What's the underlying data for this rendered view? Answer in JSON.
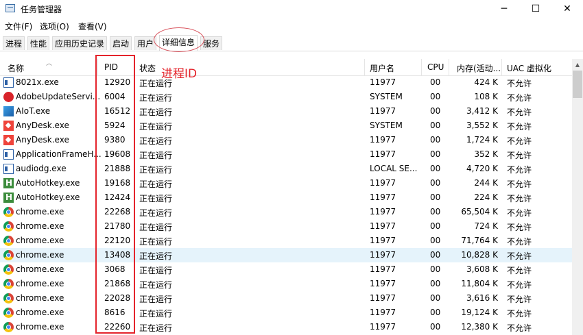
{
  "window": {
    "title": "任务管理器",
    "controls": {
      "minimize": "─",
      "maximize": "☐",
      "close": "✕"
    }
  },
  "menu": [
    "文件(F)",
    "选项(O)",
    "查看(V)"
  ],
  "tabs": [
    "进程",
    "性能",
    "应用历史记录",
    "启动",
    "用户",
    "详细信息",
    "服务"
  ],
  "active_tab": "详细信息",
  "columns": {
    "name": "名称",
    "pid": "PID",
    "status": "状态",
    "user": "用户名",
    "cpu": "CPU",
    "memory": "内存(活动...",
    "uac": "UAC 虚拟化"
  },
  "annotation": "进程ID",
  "rows": [
    {
      "name": "8021x.exe",
      "pid": "12920",
      "status": "正在运行",
      "user": "11977",
      "cpu": "00",
      "memory": "424 K",
      "uac": "不允许",
      "icon": "window-app-icon"
    },
    {
      "name": "AdobeUpdateServi...",
      "pid": "6004",
      "status": "正在运行",
      "user": "SYSTEM",
      "cpu": "00",
      "memory": "108 K",
      "uac": "不允许",
      "icon": "adobe-icon"
    },
    {
      "name": "AIoT.exe",
      "pid": "16512",
      "status": "正在运行",
      "user": "11977",
      "cpu": "00",
      "memory": "3,412 K",
      "uac": "不允许",
      "icon": "aiot-icon"
    },
    {
      "name": "AnyDesk.exe",
      "pid": "5924",
      "status": "正在运行",
      "user": "SYSTEM",
      "cpu": "00",
      "memory": "3,552 K",
      "uac": "不允许",
      "icon": "anydesk-icon"
    },
    {
      "name": "AnyDesk.exe",
      "pid": "9380",
      "status": "正在运行",
      "user": "11977",
      "cpu": "00",
      "memory": "1,724 K",
      "uac": "不允许",
      "icon": "anydesk-icon"
    },
    {
      "name": "ApplicationFrameH...",
      "pid": "19608",
      "status": "正在运行",
      "user": "11977",
      "cpu": "00",
      "memory": "352 K",
      "uac": "不允许",
      "icon": "window-app-icon"
    },
    {
      "name": "audiodg.exe",
      "pid": "21888",
      "status": "正在运行",
      "user": "LOCAL SE...",
      "cpu": "00",
      "memory": "4,720 K",
      "uac": "不允许",
      "icon": "window-app-icon"
    },
    {
      "name": "AutoHotkey.exe",
      "pid": "19168",
      "status": "正在运行",
      "user": "11977",
      "cpu": "00",
      "memory": "244 K",
      "uac": "不允许",
      "icon": "autohotkey-icon"
    },
    {
      "name": "AutoHotkey.exe",
      "pid": "12424",
      "status": "正在运行",
      "user": "11977",
      "cpu": "00",
      "memory": "224 K",
      "uac": "不允许",
      "icon": "autohotkey-icon"
    },
    {
      "name": "chrome.exe",
      "pid": "22268",
      "status": "正在运行",
      "user": "11977",
      "cpu": "00",
      "memory": "65,504 K",
      "uac": "不允许",
      "icon": "chrome-icon"
    },
    {
      "name": "chrome.exe",
      "pid": "21780",
      "status": "正在运行",
      "user": "11977",
      "cpu": "00",
      "memory": "724 K",
      "uac": "不允许",
      "icon": "chrome-icon"
    },
    {
      "name": "chrome.exe",
      "pid": "22120",
      "status": "正在运行",
      "user": "11977",
      "cpu": "00",
      "memory": "71,764 K",
      "uac": "不允许",
      "icon": "chrome-icon"
    },
    {
      "name": "chrome.exe",
      "pid": "13408",
      "status": "正在运行",
      "user": "11977",
      "cpu": "00",
      "memory": "10,828 K",
      "uac": "不允许",
      "icon": "chrome-icon",
      "selected": true
    },
    {
      "name": "chrome.exe",
      "pid": "3068",
      "status": "正在运行",
      "user": "11977",
      "cpu": "00",
      "memory": "3,608 K",
      "uac": "不允许",
      "icon": "chrome-icon"
    },
    {
      "name": "chrome.exe",
      "pid": "21868",
      "status": "正在运行",
      "user": "11977",
      "cpu": "00",
      "memory": "11,804 K",
      "uac": "不允许",
      "icon": "chrome-icon"
    },
    {
      "name": "chrome.exe",
      "pid": "22028",
      "status": "正在运行",
      "user": "11977",
      "cpu": "00",
      "memory": "3,616 K",
      "uac": "不允许",
      "icon": "chrome-icon"
    },
    {
      "name": "chrome.exe",
      "pid": "8616",
      "status": "正在运行",
      "user": "11977",
      "cpu": "00",
      "memory": "19,124 K",
      "uac": "不允许",
      "icon": "chrome-icon"
    },
    {
      "name": "chrome.exe",
      "pid": "22260",
      "status": "正在运行",
      "user": "11977",
      "cpu": "00",
      "memory": "12,380 K",
      "uac": "不允许",
      "icon": "chrome-icon"
    }
  ]
}
